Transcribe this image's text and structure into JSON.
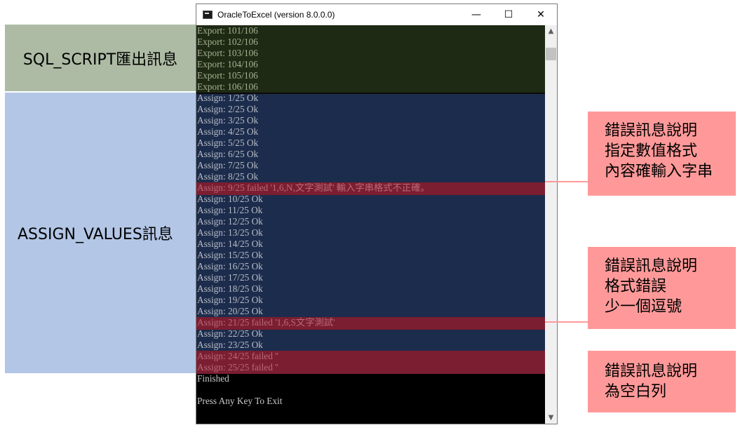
{
  "window": {
    "title": "OracleToExcel (version 8.0.0.0)",
    "minimize_glyph": "—",
    "maximize_glyph": "☐",
    "close_glyph": "✕"
  },
  "labels": {
    "sql_script": "SQL_SCRIPT匯出訊息",
    "assign_values": "ASSIGN_VALUES訊息"
  },
  "console": {
    "export_lines": [
      "Export: 101/106",
      "Export: 102/106",
      "Export: 103/106",
      "Export: 104/106",
      "Export: 105/106",
      "Export: 106/106"
    ],
    "assign_lines": [
      "Assign: 1/25 Ok",
      "Assign: 2/25 Ok",
      "Assign: 3/25 Ok",
      "Assign: 4/25 Ok",
      "Assign: 5/25 Ok",
      "Assign: 6/25 Ok",
      "Assign: 7/25 Ok",
      "Assign: 8/25 Ok",
      "Assign: 9/25 failed '1,6,N,文字測試' 輸入字串格式不正確。",
      "Assign: 10/25 Ok",
      "Assign: 11/25 Ok",
      "Assign: 12/25 Ok",
      "Assign: 13/25 Ok",
      "Assign: 14/25 Ok",
      "Assign: 15/25 Ok",
      "Assign: 16/25 Ok",
      "Assign: 17/25 Ok",
      "Assign: 18/25 Ok",
      "Assign: 19/25 Ok",
      "Assign: 20/25 Ok",
      "Assign: 21/25 failed '1,6,S文字測試'",
      "Assign: 22/25 Ok",
      "Assign: 23/25 Ok",
      "Assign: 24/25 failed ''",
      "Assign: 25/25 failed ''"
    ],
    "finished": "Finished",
    "press_key": "Press Any Key To Exit"
  },
  "callouts": [
    {
      "lines": [
        "錯誤訊息說明",
        "指定數值格式",
        "內容確輸入字串"
      ]
    },
    {
      "lines": [
        "錯誤訊息說明",
        "格式錯誤",
        "少一個逗號"
      ]
    },
    {
      "lines": [
        "錯誤訊息說明",
        "為空白列"
      ]
    }
  ],
  "colors": {
    "export_bg": "#1e2a14",
    "assign_bg": "#1c2c4c",
    "error_highlight": "#7b1e31",
    "callout_bg": "#ff9999",
    "sql_label_bg": "#adbba4",
    "assign_label_bg": "#b3c6e6"
  }
}
